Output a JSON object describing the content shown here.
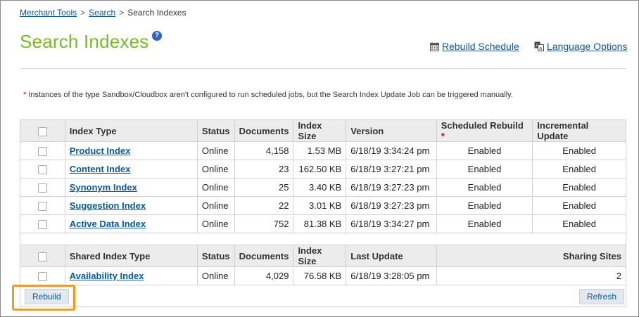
{
  "breadcrumb": {
    "items": [
      "Merchant Tools",
      "Search"
    ],
    "current": "Search Indexes",
    "separator": ">"
  },
  "page": {
    "title": "Search Indexes",
    "help": "?"
  },
  "links": {
    "rebuild_schedule": "Rebuild Schedule",
    "language_options": "Language Options"
  },
  "note": "Instances of the type Sandbox/Cloudbox aren't configured to run scheduled jobs, but the Search Index Update Job can be triggered manually.",
  "indexes": {
    "headers": [
      "Index Type",
      "Status",
      "Documents",
      "Index Size",
      "Version",
      "Scheduled Rebuild",
      "Incremental Update"
    ],
    "rows": [
      {
        "type": "Product Index",
        "status": "Online",
        "documents": "4,158",
        "size": "1.53 MB",
        "version": "6/18/19 3:34:24 pm",
        "scheduled": "Enabled",
        "incremental": "Enabled"
      },
      {
        "type": "Content Index",
        "status": "Online",
        "documents": "23",
        "size": "162.50 KB",
        "version": "6/18/19 3:27:21 pm",
        "scheduled": "Enabled",
        "incremental": "Enabled"
      },
      {
        "type": "Synonym Index",
        "status": "Online",
        "documents": "25",
        "size": "3.40 KB",
        "version": "6/18/19 3:27:23 pm",
        "scheduled": "Enabled",
        "incremental": "Enabled"
      },
      {
        "type": "Suggestion Index",
        "status": "Online",
        "documents": "22",
        "size": "3.01 KB",
        "version": "6/18/19 3:27:23 pm",
        "scheduled": "Enabled",
        "incremental": "Enabled"
      },
      {
        "type": "Active Data Index",
        "status": "Online",
        "documents": "752",
        "size": "81.38 KB",
        "version": "6/18/19 3:34:27 pm",
        "scheduled": "Enabled",
        "incremental": "Enabled"
      }
    ]
  },
  "shared": {
    "headers": [
      "Shared Index Type",
      "Status",
      "Documents",
      "Index Size",
      "Last Update",
      "Sharing Sites"
    ],
    "rows": [
      {
        "type": "Availability Index",
        "status": "Online",
        "documents": "4,029",
        "size": "76.58 KB",
        "update": "6/18/19 3:28:05 pm",
        "sites": "2"
      }
    ]
  },
  "buttons": {
    "rebuild": "Rebuild",
    "refresh": "Refresh"
  },
  "colors": {
    "title": "#7ab929",
    "link": "#0b5a95",
    "highlight": "#f39b21",
    "required": "#d0021b"
  }
}
